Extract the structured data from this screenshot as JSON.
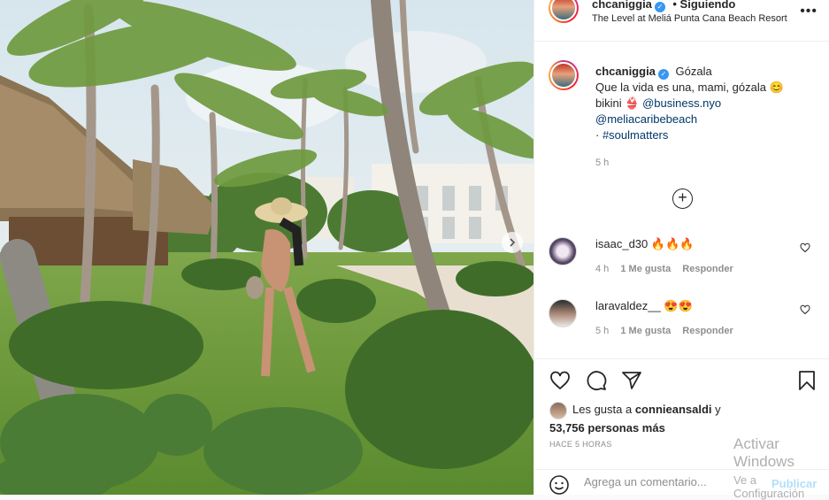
{
  "post": {
    "photo_alt": "",
    "next_icon": "chevron-right-icon"
  },
  "header": {
    "username": "chcaniggia",
    "follow_status": "• Siguiendo",
    "location": "The Level at Meliá Punta Cana Beach Resort",
    "more_icon": "•••"
  },
  "caption": {
    "username": "chcaniggia",
    "title": "Gózala",
    "line1": "Que la vida es una, mami, gózala 😊",
    "bikini_label": "bikini 👙",
    "mention1": "@business.nyo",
    "mention2": "@meliacaribebeach",
    "hashtag_prefix": "· ",
    "hashtag": "#soulmatters",
    "time": "5 h"
  },
  "load_more_icon": "plus-circle-icon",
  "comments": [
    {
      "username": "isaac_d30",
      "text": "🔥🔥🔥",
      "time": "4 h",
      "likes": "1 Me gusta",
      "reply": "Responder"
    },
    {
      "username": "laravaldez__",
      "text": "😍😍",
      "time": "5 h",
      "likes": "1 Me gusta",
      "reply": "Responder"
    }
  ],
  "likes": {
    "prefix": "Les gusta a ",
    "user": "connieansaldi",
    "middle": " y",
    "count": "53,756 personas más"
  },
  "timestamp": "HACE 5 HORAS",
  "add_comment": {
    "placeholder": "Agrega un comentario...",
    "publish": "Publicar"
  },
  "watermark": {
    "line1": "Activar Windows",
    "line2": "Ve a Configuración"
  },
  "colors": {
    "link": "#00376b",
    "verified": "#3897f0",
    "publish": "#b2dffc"
  }
}
